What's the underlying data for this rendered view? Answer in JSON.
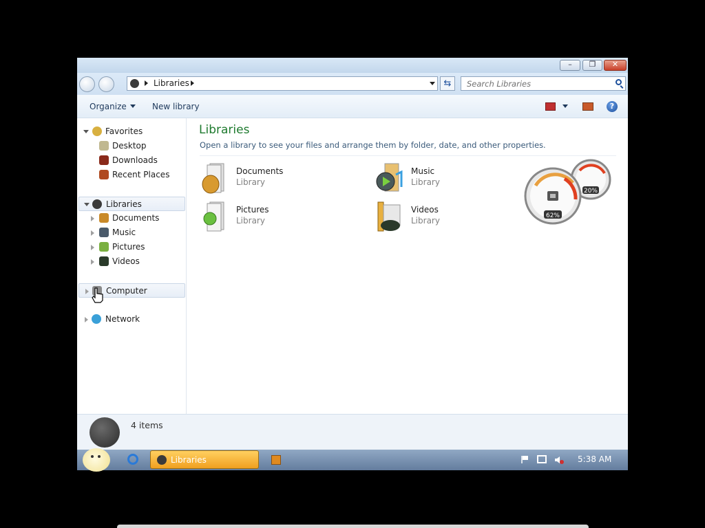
{
  "address": {
    "breadcrumb": "Libraries"
  },
  "search": {
    "placeholder": "Search Libraries"
  },
  "toolbar": {
    "organize_label": "Organize",
    "new_library_label": "New library"
  },
  "navpane": {
    "favorites": {
      "label": "Favorites",
      "items": [
        "Desktop",
        "Downloads",
        "Recent Places"
      ]
    },
    "libraries": {
      "label": "Libraries",
      "items": [
        "Documents",
        "Music",
        "Pictures",
        "Videos"
      ]
    },
    "computer": {
      "label": "Computer"
    },
    "network": {
      "label": "Network"
    }
  },
  "content": {
    "title": "Libraries",
    "subtitle": "Open a library to see your files and arrange them by folder, date, and other properties.",
    "libraries": [
      {
        "name": "Documents",
        "type": "Library",
        "icon": "documents-library-icon"
      },
      {
        "name": "Music",
        "type": "Library",
        "icon": "music-library-icon"
      },
      {
        "name": "Pictures",
        "type": "Library",
        "icon": "pictures-library-icon"
      },
      {
        "name": "Videos",
        "type": "Library",
        "icon": "videos-library-icon"
      }
    ]
  },
  "gadget": {
    "cpu_label": "62%",
    "memory_label": "20%"
  },
  "status": {
    "item_count": "4 items"
  },
  "taskbar": {
    "active_window": "Libraries",
    "clock": "5:38 AM"
  },
  "colors": {
    "title_green": "#1e7a2e",
    "taskbar_active": "#f0a020",
    "close_red": "#c8402a"
  }
}
